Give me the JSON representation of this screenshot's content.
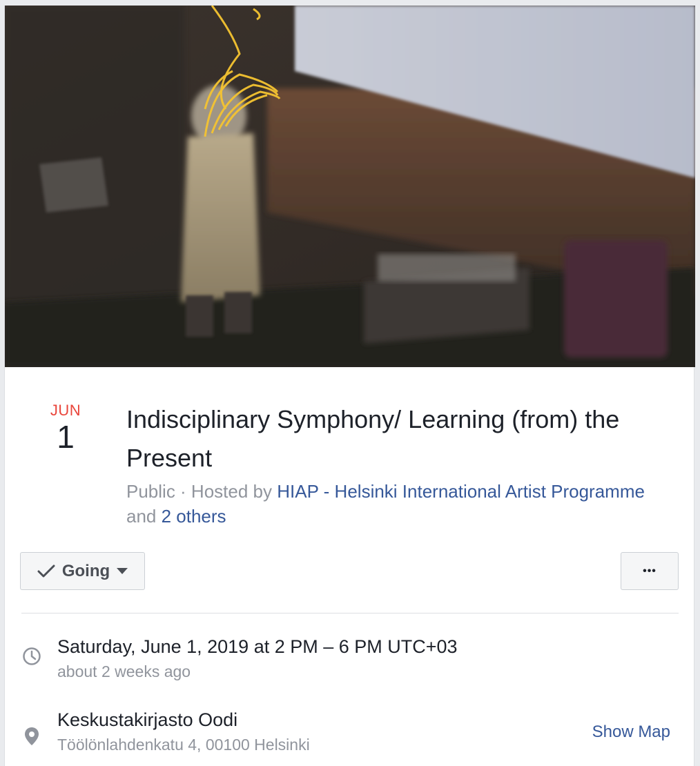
{
  "event": {
    "month": "JUN",
    "day": "1",
    "title": "Indisciplinary Symphony/ Learning (from) the Present",
    "privacy": "Public",
    "hosted_by_prefix": " · Hosted by ",
    "host_name": "HIAP - Helsinki International Artist Programme",
    "and_text": " and ",
    "others_link": "2 others"
  },
  "actions": {
    "going_label": "Going",
    "more_label": "•••"
  },
  "details": {
    "datetime": "Saturday, June 1, 2019 at 2 PM – 6 PM UTC+03",
    "relative_time": "about 2 weeks ago",
    "location_name": "Keskustakirjasto Oodi",
    "address": "Töölönlahdenkatu 4, 00100 Helsinki",
    "show_map_label": "Show Map"
  },
  "icons": {
    "cover": "event-cover-photo",
    "check": "check-icon",
    "caret": "caret-down-icon",
    "more": "more-options-icon",
    "clock": "clock-icon",
    "pin": "location-pin-icon"
  },
  "colors": {
    "date_month": "#e9453b",
    "link": "#365899",
    "secondary_text": "#90949c",
    "primary_text": "#1d2129",
    "button_bg": "#f5f6f7",
    "border": "#dddfe2"
  }
}
